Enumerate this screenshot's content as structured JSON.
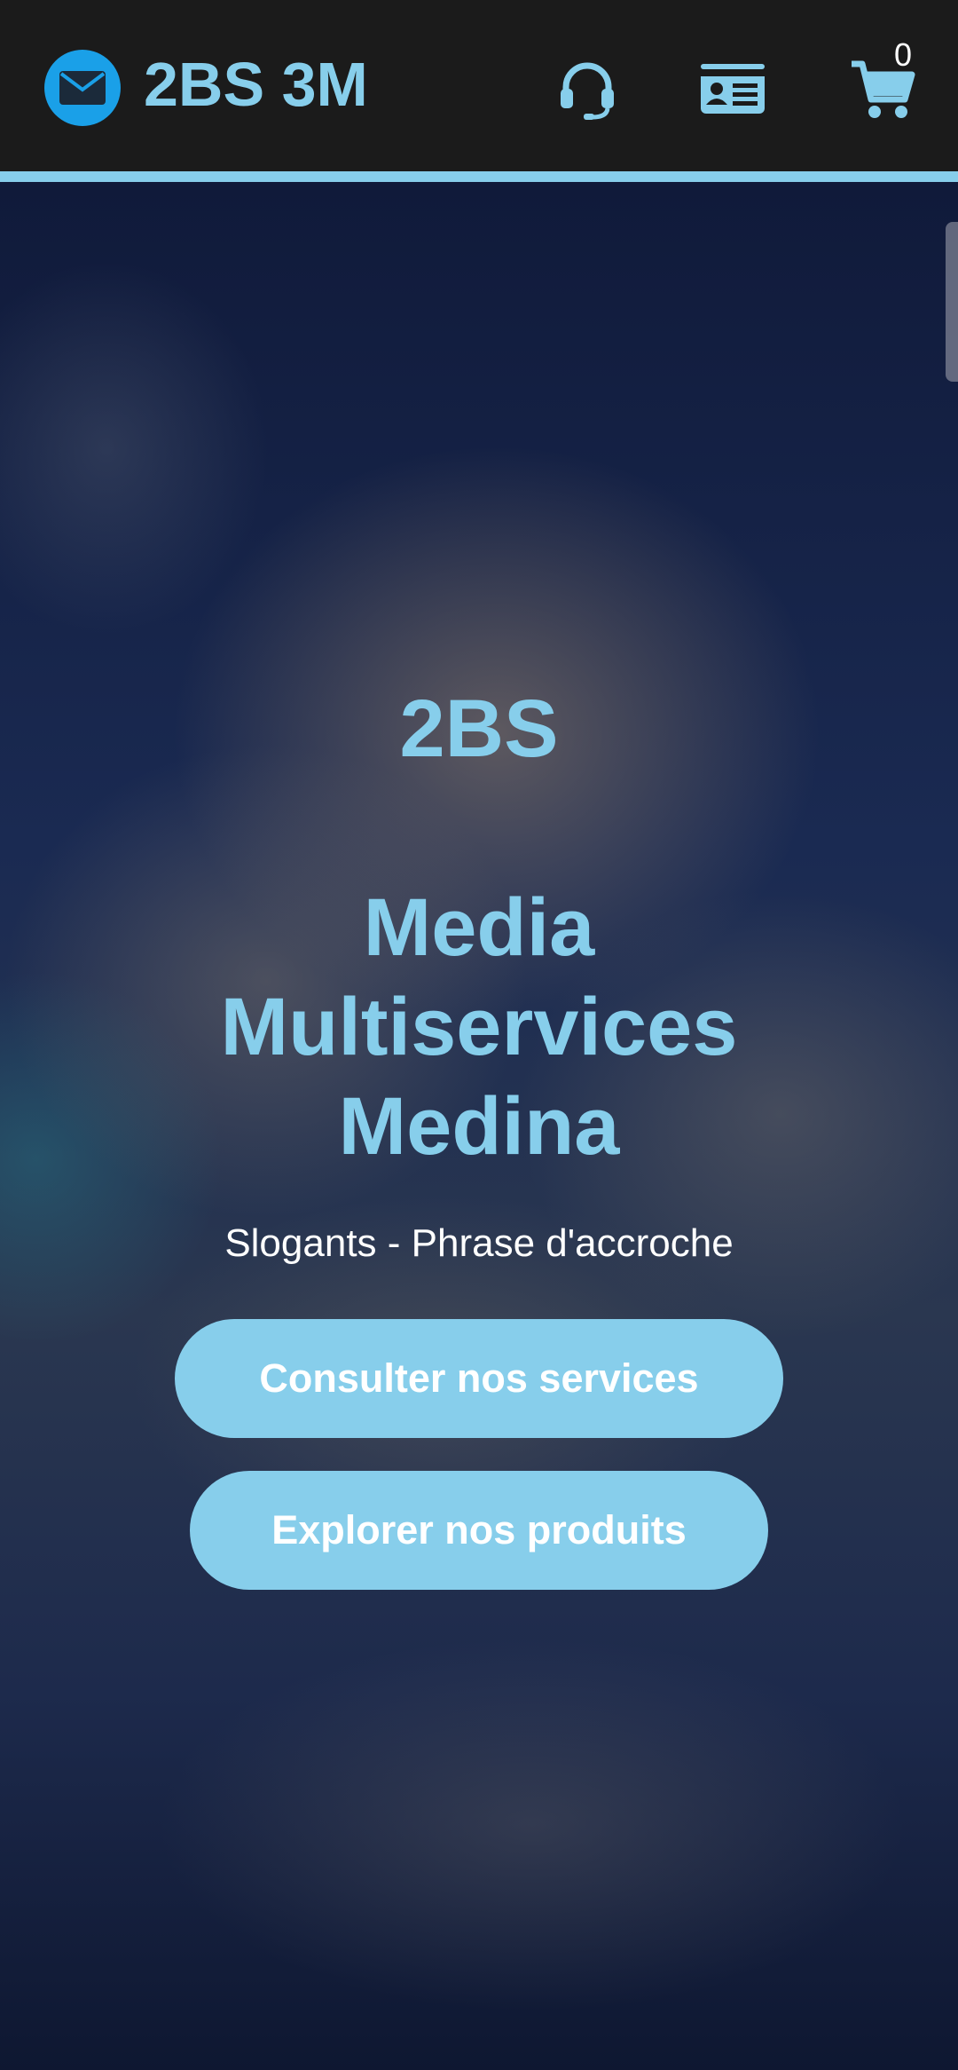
{
  "header": {
    "brand": "2BS 3M",
    "cart_count": "0",
    "icons": {
      "logo": "envelope-icon",
      "support": "headset-icon",
      "contact": "contact-card-icon",
      "cart": "cart-icon"
    }
  },
  "hero": {
    "title_line1": "2BS",
    "title_line2": "Media",
    "title_line3": "Multiservices",
    "title_line4": "Medina",
    "slogan": "Slogants - Phrase d'accroche",
    "buttons": {
      "services": "Consulter nos services",
      "products": "Explorer nos produits"
    }
  },
  "colors": {
    "accent": "#87ceeb",
    "header_bg": "#1b1b1b",
    "logo_blue": "#1aa0e8"
  }
}
